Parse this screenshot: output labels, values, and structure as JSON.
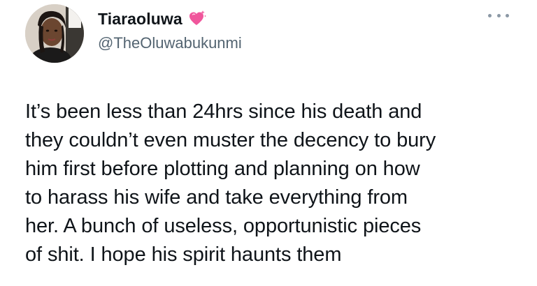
{
  "tweet": {
    "author": {
      "display_name": "Tiaraoluwa",
      "handle": "@TheOluwabukunmi",
      "name_emoji_icon": "sparkling-heart-icon",
      "avatar_icon": "profile-photo"
    },
    "more_icon": "more-options-icon",
    "text": "It’s been less than 24hrs since his death and\nthey couldn’t even muster the decency to bury\nhim first before plotting and planning on how\nto harass his wife and take everything from\nher. A bunch of useless, opportunistic pieces\nof shit. I hope his spirit haunts them"
  },
  "colors": {
    "text_primary": "#0f1419",
    "text_secondary": "#536471",
    "heart": "#f0569c",
    "background": "#ffffff"
  }
}
